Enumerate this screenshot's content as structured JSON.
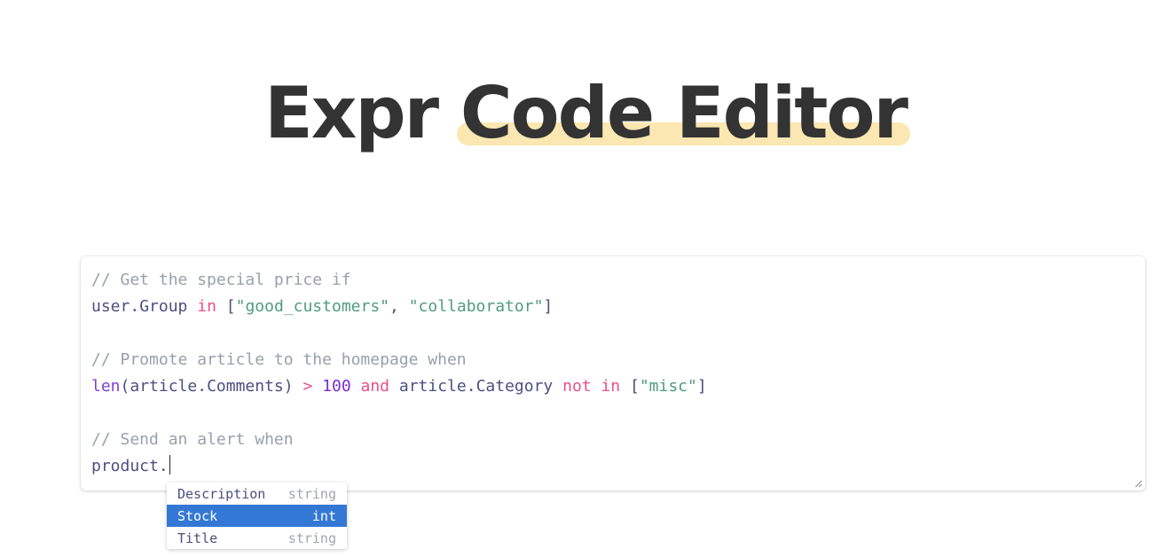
{
  "header": {
    "title_plain": "Expr",
    "title_highlight": "Code Editor",
    "highlight_color": "#fbe7b1"
  },
  "editor": {
    "lines": [
      [
        {
          "t": "// Get the special price if",
          "k": "comment"
        }
      ],
      [
        {
          "t": "user",
          "k": "ident"
        },
        {
          "t": ".",
          "k": "punct"
        },
        {
          "t": "Group",
          "k": "ident"
        },
        {
          "t": " ",
          "k": "punct"
        },
        {
          "t": "in",
          "k": "kw"
        },
        {
          "t": " [",
          "k": "punct"
        },
        {
          "t": "\"good_customers\"",
          "k": "str"
        },
        {
          "t": ", ",
          "k": "punct"
        },
        {
          "t": "\"collaborator\"",
          "k": "str"
        },
        {
          "t": "]",
          "k": "punct"
        }
      ],
      [],
      [
        {
          "t": "// Promote article to the homepage when",
          "k": "comment"
        }
      ],
      [
        {
          "t": "len",
          "k": "fn"
        },
        {
          "t": "(",
          "k": "punct"
        },
        {
          "t": "article",
          "k": "ident"
        },
        {
          "t": ".",
          "k": "punct"
        },
        {
          "t": "Comments",
          "k": "ident"
        },
        {
          "t": ") ",
          "k": "punct"
        },
        {
          "t": ">",
          "k": "kw"
        },
        {
          "t": " ",
          "k": "punct"
        },
        {
          "t": "100",
          "k": "num"
        },
        {
          "t": " ",
          "k": "punct"
        },
        {
          "t": "and",
          "k": "kw"
        },
        {
          "t": " ",
          "k": "punct"
        },
        {
          "t": "article",
          "k": "ident"
        },
        {
          "t": ".",
          "k": "punct"
        },
        {
          "t": "Category",
          "k": "ident"
        },
        {
          "t": " ",
          "k": "punct"
        },
        {
          "t": "not in",
          "k": "kw"
        },
        {
          "t": " [",
          "k": "punct"
        },
        {
          "t": "\"misc\"",
          "k": "str"
        },
        {
          "t": "]",
          "k": "punct"
        }
      ],
      [],
      [
        {
          "t": "// Send an alert when",
          "k": "comment"
        }
      ],
      [
        {
          "t": "product",
          "k": "ident"
        },
        {
          "t": ".",
          "k": "punct"
        }
      ]
    ],
    "cursor_line": 7
  },
  "autocomplete": {
    "items": [
      {
        "name": "Description",
        "type": "string",
        "selected": false
      },
      {
        "name": "Stock",
        "type": "int",
        "selected": true
      },
      {
        "name": "Title",
        "type": "string",
        "selected": false
      }
    ],
    "selected_color": "#3478d6"
  }
}
